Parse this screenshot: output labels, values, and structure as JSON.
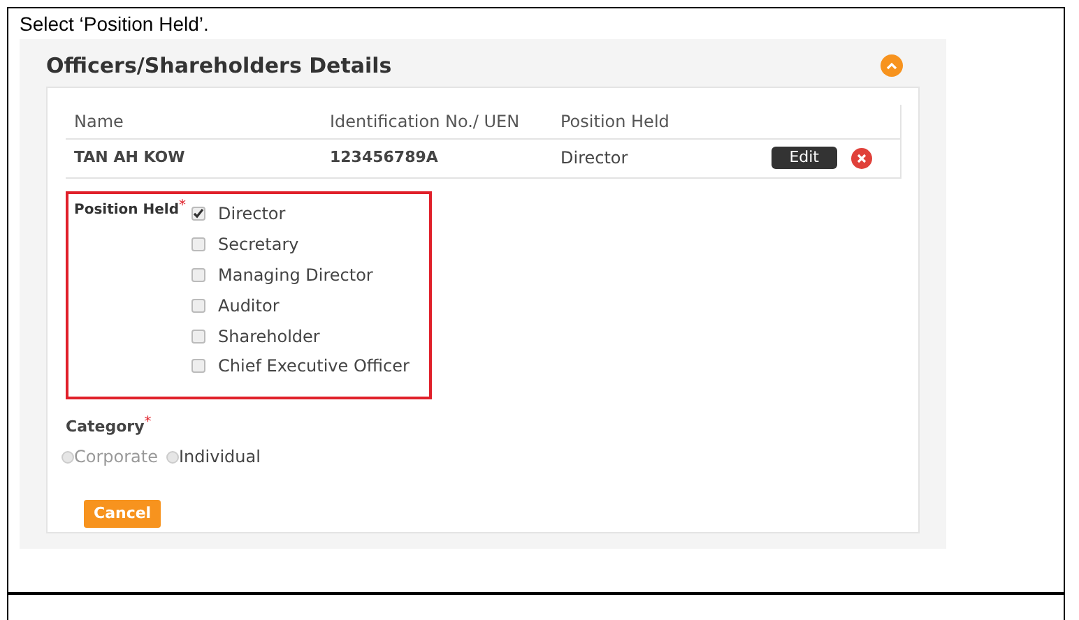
{
  "instruction": "Select ‘Position Held’.",
  "panel": {
    "title": "Officers/Shareholders Details",
    "expanded": true
  },
  "table": {
    "columns": [
      "Name",
      "Identification No./ UEN",
      "Position Held"
    ],
    "rows": [
      {
        "name": "TAN AH KOW",
        "id": "123456789A",
        "position": "Director",
        "edit_label": "Edit"
      }
    ]
  },
  "position_field": {
    "label": "Position Held",
    "required_mark": "*",
    "highlighted": true,
    "options": [
      {
        "label": "Director",
        "checked": true
      },
      {
        "label": "Secretary",
        "checked": false
      },
      {
        "label": "Managing Director",
        "checked": false
      },
      {
        "label": "Auditor",
        "checked": false
      },
      {
        "label": "Shareholder",
        "checked": false
      },
      {
        "label": "Chief Executive Officer",
        "checked": false
      }
    ]
  },
  "category_field": {
    "label": "Category",
    "required_mark": "*",
    "disabled": true,
    "options": [
      {
        "label": "Corporate",
        "selected": false
      },
      {
        "label": "Individual",
        "selected": false
      }
    ]
  },
  "buttons": [
    "Cancel"
  ]
}
